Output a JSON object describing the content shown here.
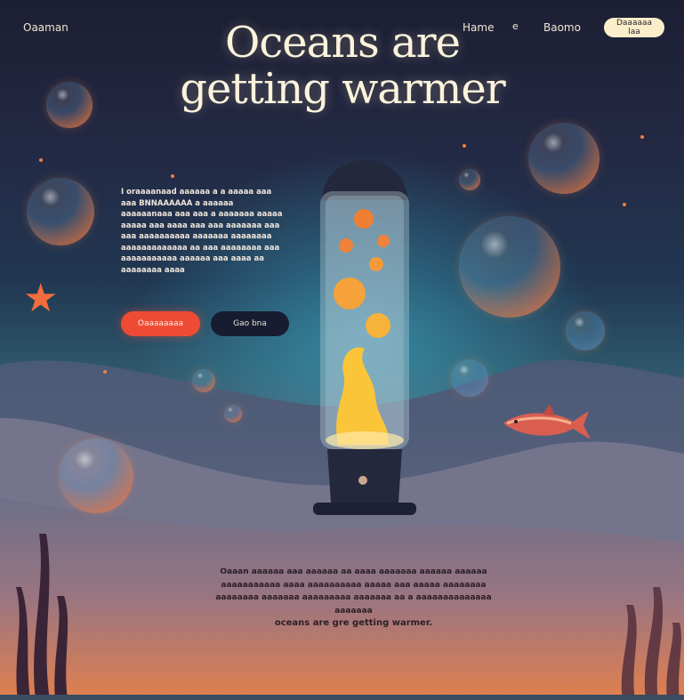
{
  "nav": {
    "logo": "Oaaman",
    "home": "Hame",
    "separator": "e",
    "item2": "Baomo",
    "cta": "Daaaaaa laa"
  },
  "hero": {
    "title_line1": "Oceans are",
    "title_line2": "getting warmer",
    "body": "I oraaaanaad aaaaaa a a aaaaa aaa aaa BNNAAAAAA a aaaaaa aaaaaanaaa aaa aaa a aaaaaaa aaaaa aaaaa aaa aaaa aaa aaa aaaaaaa aaa aaa aaaaaaaaaa aaaaaaa aaaaaaaa aaaaaaaaaaaaa aa aaa aaaaaaaa aaa aaaaaaaaaaa aaaaaa aaa aaaa aa aaaaaaaa aaaa",
    "primary_button": "Oaaaaaaaa",
    "secondary_button": "Gao bna"
  },
  "footer_text": {
    "body": "Oaaan aaaaaa aaa aaaaaa aa aaaa aaaaaaa aaaaaa aaaaaa aaaaaaaaaaa aaaa aaaaaaaaaa aaaaa aaa aaaaa aaaaaaaa aaaaaaaa aaaaaaa aaaaaaaaa aaaaaaa aa a aaaaaaaaaaaaaa aaaaaaa",
    "last_line": "oceans are gre getting warmer."
  },
  "colors": {
    "accent": "#ee4b35",
    "cta_bg": "#fbeecb",
    "dark_button": "#171c30",
    "title": "#fbf3dc"
  },
  "icons": {
    "starfish": "starfish-icon",
    "fish": "fish-icon",
    "lava_lamp": "lava-lamp-icon",
    "seaweed": "seaweed-icon"
  }
}
